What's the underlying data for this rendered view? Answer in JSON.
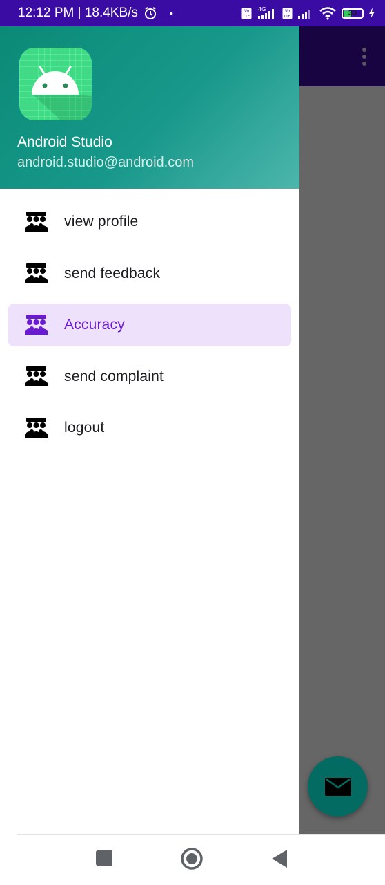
{
  "status_bar": {
    "time_speed": "12:12 PM | 18.4KB/s",
    "dot": "•",
    "icons": [
      "alarm-icon",
      "volte-icon",
      "signal-4g-icon",
      "volte-icon",
      "signal-icon",
      "wifi-icon",
      "battery-icon",
      "charging-icon"
    ],
    "network_4g": "4G",
    "volte_label": "Vo LTE",
    "battery_level": "33"
  },
  "drawer": {
    "header": {
      "user_name": "Android Studio",
      "user_email": "android.studio@android.com",
      "logo": "android-studio-logo"
    },
    "menu": [
      {
        "label": "view profile",
        "icon": "people-group-icon",
        "active": false
      },
      {
        "label": "send feedback",
        "icon": "people-group-icon",
        "active": false
      },
      {
        "label": "Accuracy",
        "icon": "people-group-icon",
        "active": true
      },
      {
        "label": "send complaint",
        "icon": "people-group-icon",
        "active": false
      },
      {
        "label": "logout",
        "icon": "people-group-icon",
        "active": false
      }
    ]
  },
  "app": {
    "fab_icon": "email-icon",
    "toolbar_menu_icon": "overflow-menu-icon"
  },
  "colors": {
    "status_bar": "#3a0ca3",
    "header_gradient_start": "#0b8a76",
    "header_gradient_end": "#4db6ac",
    "active_item_bg": "#ede1fb",
    "active_item_text": "#6a1bd1",
    "fab": "#036b62"
  }
}
